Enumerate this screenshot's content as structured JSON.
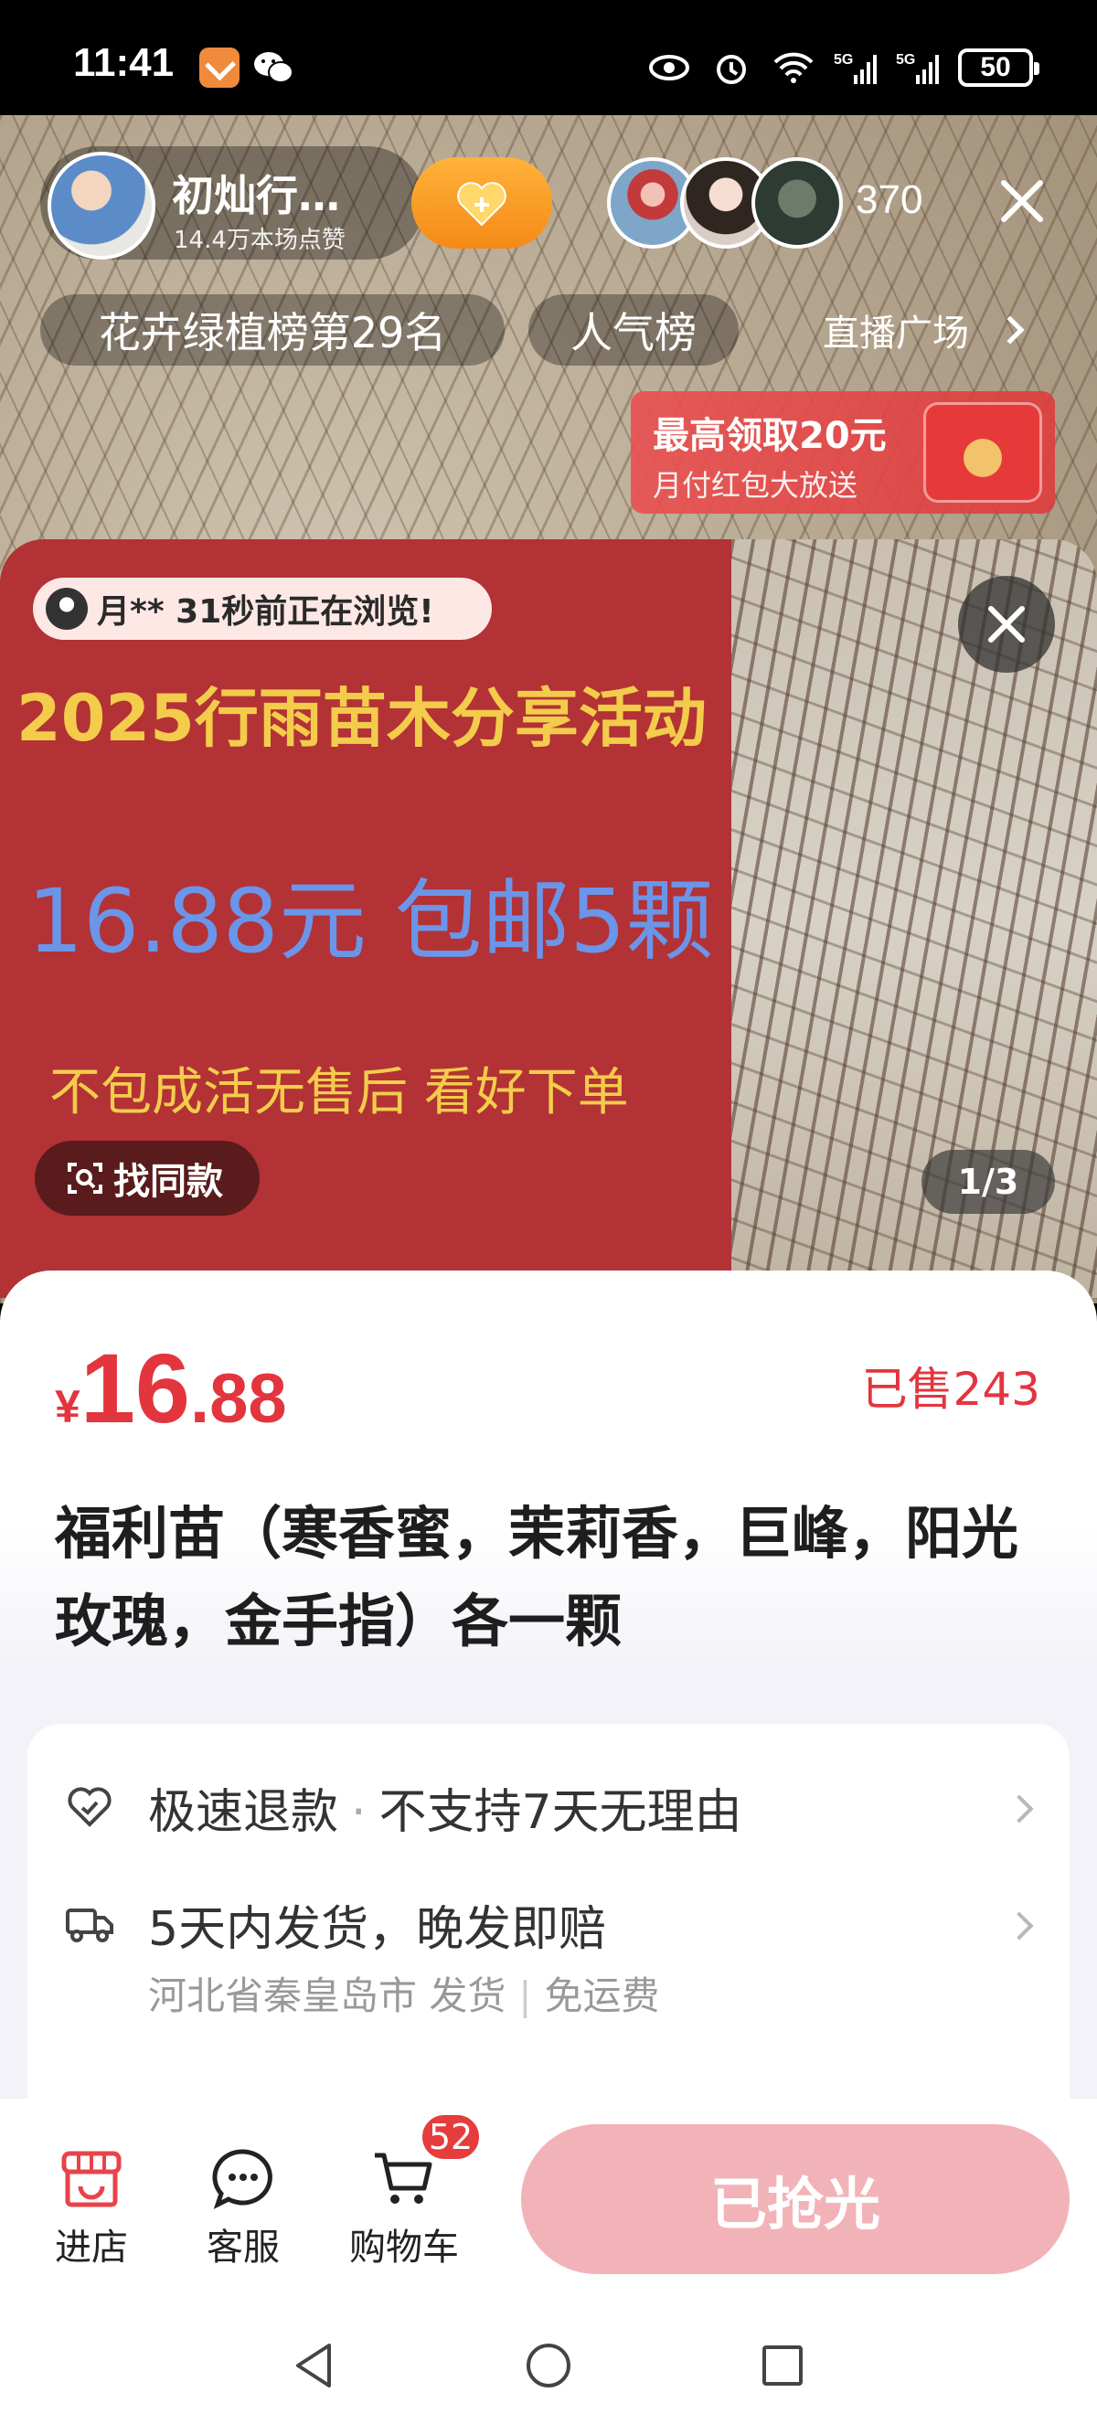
{
  "status_bar": {
    "time": "11:41",
    "battery": "50",
    "network": "5G"
  },
  "live": {
    "anchor_name": "初灿行…",
    "anchor_likes": "14.4万本场点赞",
    "viewer_count": "370",
    "rank_label": "花卉绿植榜第29名",
    "popular_label": "人气榜",
    "plaza_label": "直播广场",
    "redpack_title": "最高领取20元",
    "redpack_subtitle": "月付红包大放送"
  },
  "product_image": {
    "browsing_text": "月** 31秒前正在浏览!",
    "poster_title": "2025行雨苗木分享活动",
    "poster_price": "16.88元  包邮5颗",
    "poster_note": "不包成活无售后  看好下单",
    "find_similar": "找同款",
    "pager": "1/3",
    "poster_color": "#b23236"
  },
  "product": {
    "currency": "¥",
    "price_int": "16",
    "price_dec": ".88",
    "sold": "已售243",
    "title": "福利苗（寒香蜜，茉莉香，巨峰，阳光玫瑰，金手指）各一颗",
    "accent_color": "#e3353e"
  },
  "services": {
    "refund": "极速退款",
    "refund_dot": "·",
    "refund_note": "不支持7天无理由",
    "shipping": "5天内发货，晚发即赔",
    "ship_from": "河北省秦皇岛市 发货",
    "ship_fee": "免运费"
  },
  "action_bar": {
    "store": "进店",
    "service": "客服",
    "cart": "购物车",
    "cart_count": "52",
    "buy_button": "已抢光"
  },
  "icons": {
    "follow": "heart-plus-icon",
    "close": "close-icon",
    "refund": "heart-shield-icon",
    "shipping": "truck-icon",
    "store": "store-icon",
    "service": "chat-icon",
    "cart": "cart-icon"
  }
}
